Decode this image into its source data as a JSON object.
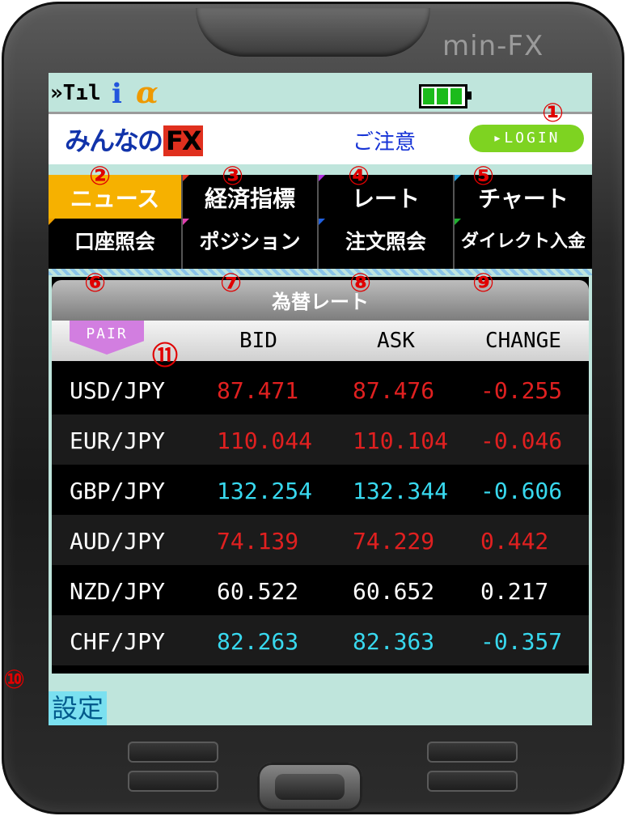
{
  "device": {
    "brand": "min-FX"
  },
  "status_bar": {
    "signal_text": "»Tıl",
    "imode_text": "i",
    "alpha_text": "α"
  },
  "header": {
    "logo_text": "みんなの",
    "logo_fx": "FX",
    "notice_label": "ご注意",
    "login_label": "▸LOGIN"
  },
  "menu_row1": [
    {
      "label": "ニュース",
      "marker": "②",
      "active": true
    },
    {
      "label": "経済指標",
      "marker": "③"
    },
    {
      "label": "レート",
      "marker": "④"
    },
    {
      "label": "チャート",
      "marker": "⑤"
    }
  ],
  "menu_row2": [
    {
      "label": "口座照会",
      "marker": "⑥"
    },
    {
      "label": "ポジション",
      "marker": "⑦"
    },
    {
      "label": "注文照会",
      "marker": "⑧"
    },
    {
      "label": "ダイレクト入金",
      "marker": "⑨"
    }
  ],
  "rates": {
    "title": "為替レート",
    "pair_button": "PAIR",
    "columns": [
      "BID",
      "ASK",
      "CHANGE"
    ],
    "rows": [
      {
        "pair": "USD/JPY",
        "bid": "87.471",
        "ask": "87.476",
        "change": "-0.255",
        "color": "#e02020"
      },
      {
        "pair": "EUR/JPY",
        "bid": "110.044",
        "ask": "110.104",
        "change": "-0.046",
        "color": "#e02020"
      },
      {
        "pair": "GBP/JPY",
        "bid": "132.254",
        "ask": "132.344",
        "change": "-0.606",
        "color": "#38d8ee"
      },
      {
        "pair": "AUD/JPY",
        "bid": "74.139",
        "ask": "74.229",
        "change": "0.442",
        "color": "#e02020"
      },
      {
        "pair": "NZD/JPY",
        "bid": "60.522",
        "ask": "60.652",
        "change": "0.217",
        "color": "#ffffff"
      },
      {
        "pair": "CHF/JPY",
        "bid": "82.263",
        "ask": "82.363",
        "change": "-0.357",
        "color": "#38d8ee"
      }
    ]
  },
  "footer": {
    "settings_label": "設定"
  },
  "markers": {
    "login": "①",
    "settings": "⑩",
    "pair": "⑪"
  }
}
